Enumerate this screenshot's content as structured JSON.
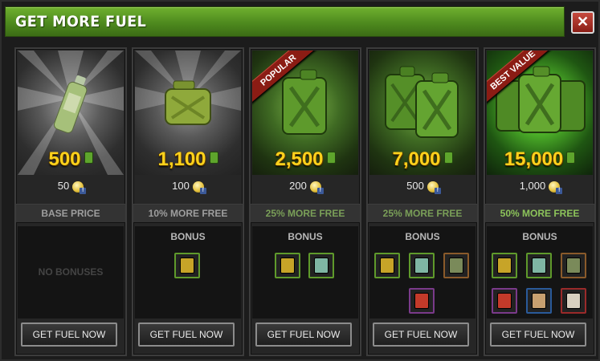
{
  "title": "GET MORE FUEL",
  "close_label": "✕",
  "colors": {
    "accent_green": "#5ea52c",
    "gold": "#ffd21c",
    "ribbon_red": "#8b1c14"
  },
  "packs": [
    {
      "amount": "500",
      "price": "50",
      "tier": "BASE PRICE",
      "bonus_label": "",
      "no_bonus": "NO BONUSES",
      "button": "GET FUEL NOW",
      "ribbon": "",
      "icon": "water-bottle-icon"
    },
    {
      "amount": "1,100",
      "price": "100",
      "tier": "10% MORE FREE",
      "bonus_label": "BONUS",
      "no_bonus": "",
      "button": "GET FUEL NOW",
      "ribbon": "",
      "icon": "jerry-can-icon"
    },
    {
      "amount": "2,500",
      "price": "200",
      "tier": "25% MORE FREE",
      "bonus_label": "BONUS",
      "no_bonus": "",
      "button": "GET FUEL NOW",
      "ribbon": "POPULAR",
      "icon": "jerry-can-icon"
    },
    {
      "amount": "7,000",
      "price": "500",
      "tier": "25% MORE FREE",
      "bonus_label": "BONUS",
      "no_bonus": "",
      "button": "GET FUEL NOW",
      "ribbon": "",
      "icon": "jerry-cans-icon"
    },
    {
      "amount": "15,000",
      "price": "1,000",
      "tier": "50% MORE FREE",
      "bonus_label": "BONUS",
      "no_bonus": "",
      "button": "GET FUEL NOW",
      "ribbon": "BEST VALUE",
      "icon": "jerry-cans-icon"
    }
  ]
}
